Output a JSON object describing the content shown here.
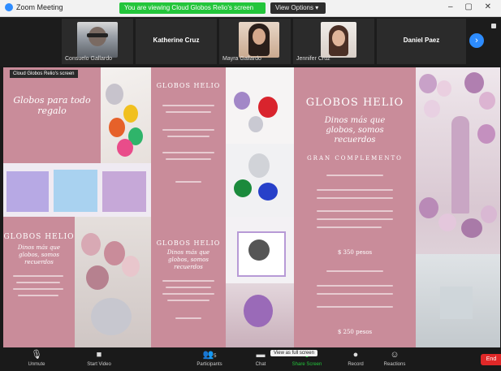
{
  "window": {
    "app_title": "Zoom Meeting",
    "share_banner": "You are viewing Cloud Globos Relio's screen",
    "view_options": "View Options ▾",
    "controls": "–  ▢  ✕"
  },
  "participants": [
    {
      "name": "Consuelo Gallardo",
      "has_video": true
    },
    {
      "name": "Katherine Cruz",
      "has_video": false
    },
    {
      "name": "Mayra Gallardo",
      "has_video": true
    },
    {
      "name": "Jennifer Cruz",
      "has_video": true
    },
    {
      "name": "Daniel Paez",
      "has_video": false
    }
  ],
  "share": {
    "label": "Cloud Globos Relio's screen",
    "brand": "GLOBOS HELIO",
    "tagline_left": "Globos para todo regalo",
    "tagline": "Dinos más que globos, somos recuerdos",
    "section": "GRAN COMPLEMENTO",
    "price1": "$ 350 pesos",
    "price2": "$ 250 pesos"
  },
  "toolbar": {
    "unmute": "Unmute",
    "start_video": "Start Video",
    "participants": "Participants",
    "participants_count": "5",
    "chat": "Chat",
    "share_screen": "Share Screen",
    "record": "Record",
    "reactions": "Reactions",
    "end": "End",
    "tooltip": "View as full screen"
  },
  "colors": {
    "brand_pink": "#c98c9a",
    "zoom_blue": "#2d8cff",
    "share_green": "#23c53b",
    "end_red": "#e02828"
  }
}
